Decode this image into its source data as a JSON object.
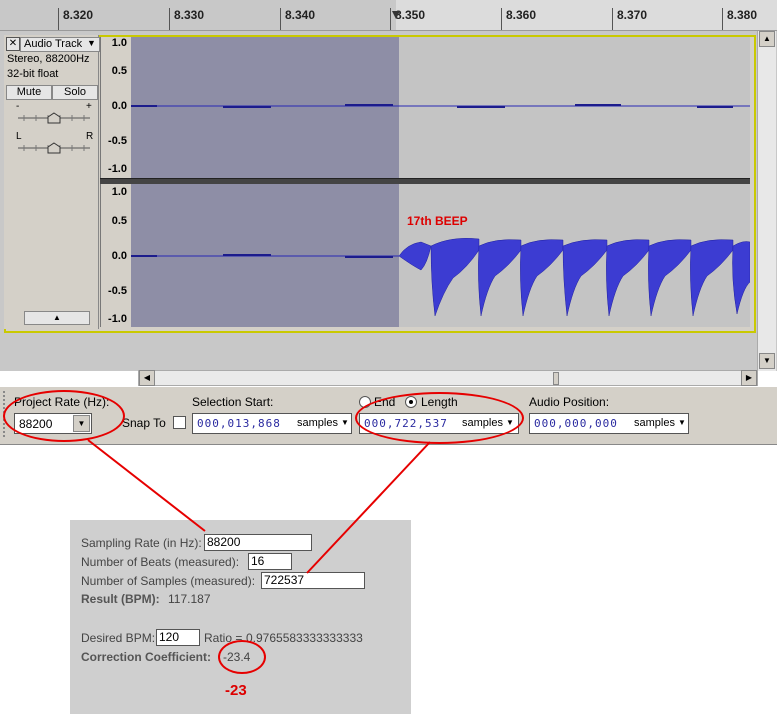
{
  "ruler": {
    "ticks": [
      "8.320",
      "8.330",
      "8.340",
      "8.350",
      "8.360",
      "8.370",
      "8.380"
    ]
  },
  "track": {
    "name": "Audio Track",
    "info_line1": "Stereo, 88200Hz",
    "info_line2": "32-bit float",
    "mute_label": "Mute",
    "solo_label": "Solo",
    "gain_minus": "-",
    "gain_plus": "+",
    "pan_left": "L",
    "pan_right": "R",
    "scale_labels": [
      "1.0",
      "0.5",
      "0.0",
      "-0.5",
      "-1.0"
    ],
    "annotation": "17th BEEP"
  },
  "toolbar": {
    "project_rate_label": "Project Rate (Hz):",
    "project_rate_value": "88200",
    "snap_to_label": "Snap To",
    "selection_start_label": "Selection Start:",
    "selection_start_value": "000,013,868",
    "end_label": "End",
    "length_label": "Length",
    "length_value": "000,722,537",
    "audio_position_label": "Audio Position:",
    "audio_position_value": "000,000,000",
    "units_label": "samples"
  },
  "calculator": {
    "sampling_rate_label": "Sampling Rate (in Hz):",
    "sampling_rate_value": "88200",
    "beats_label": "Number of Beats (measured):",
    "beats_value": "16",
    "samples_label": "Number of Samples (measured):",
    "samples_value": "722537",
    "result_label": "Result (BPM):",
    "result_value": "117.187",
    "desired_bpm_label": "Desired BPM:",
    "desired_bpm_value": "120",
    "ratio_label": "Ratio = ",
    "ratio_value": "0.9765583333333333",
    "correction_label": "Correction Coefficient:",
    "correction_value": "-23.4",
    "annotation": "-23"
  },
  "colors": {
    "annotation_red": "#e60000",
    "waveform": "#3c3cd2",
    "selection": "#8e8ea6"
  }
}
